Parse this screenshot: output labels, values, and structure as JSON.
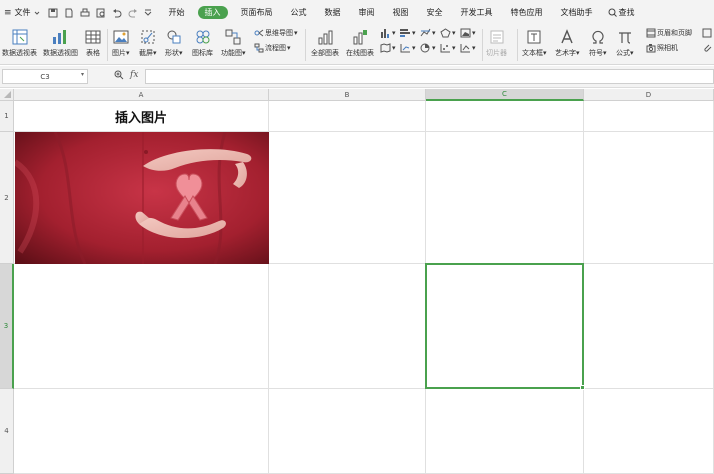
{
  "menubar": {
    "menu_glyph": "≡",
    "file_label": "文件",
    "tabs": [
      {
        "label": "开始"
      },
      {
        "label": "插入",
        "active": true
      },
      {
        "label": "页面布局"
      },
      {
        "label": "公式"
      },
      {
        "label": "数据"
      },
      {
        "label": "审阅"
      },
      {
        "label": "视图"
      },
      {
        "label": "安全"
      },
      {
        "label": "开发工具"
      },
      {
        "label": "特色应用"
      },
      {
        "label": "文档助手"
      }
    ],
    "search_label": "查找",
    "active_color": "#4aa14e"
  },
  "ribbon": {
    "pivot_table": "数据透视表",
    "pivot_chart": "数据透视图",
    "table": "表格",
    "picture": "图片",
    "screenshot": "截屏",
    "shapes": "形状",
    "icon_library": "图标库",
    "function_chart": "功能图",
    "mind_map": "思维导图",
    "flowchart": "流程图",
    "all_charts": "全部图表",
    "online_charts": "在线图表",
    "slicer": "切片器",
    "text_box": "文本框",
    "art_text": "艺术字",
    "symbol": "符号",
    "formula": "公式",
    "header_footer": "页眉和页脚",
    "camera": "照相机",
    "dropdown_arrow": "▾"
  },
  "formula_bar": {
    "name_box": "C3",
    "fx_label": "fx",
    "formula_value": ""
  },
  "sheet": {
    "columns": [
      "A",
      "B",
      "C",
      "D"
    ],
    "rows": [
      "1",
      "2",
      "3",
      "4"
    ],
    "selected_column": "C",
    "selected_row": "3",
    "a1_text": "插入图片",
    "grid_color": "#e0e0e0",
    "selection_color": "#4aa14e"
  },
  "picture": {
    "subject": "red-ribbon-hands",
    "background_color": "#b5283a",
    "ribbon_color": "#e8828c"
  }
}
